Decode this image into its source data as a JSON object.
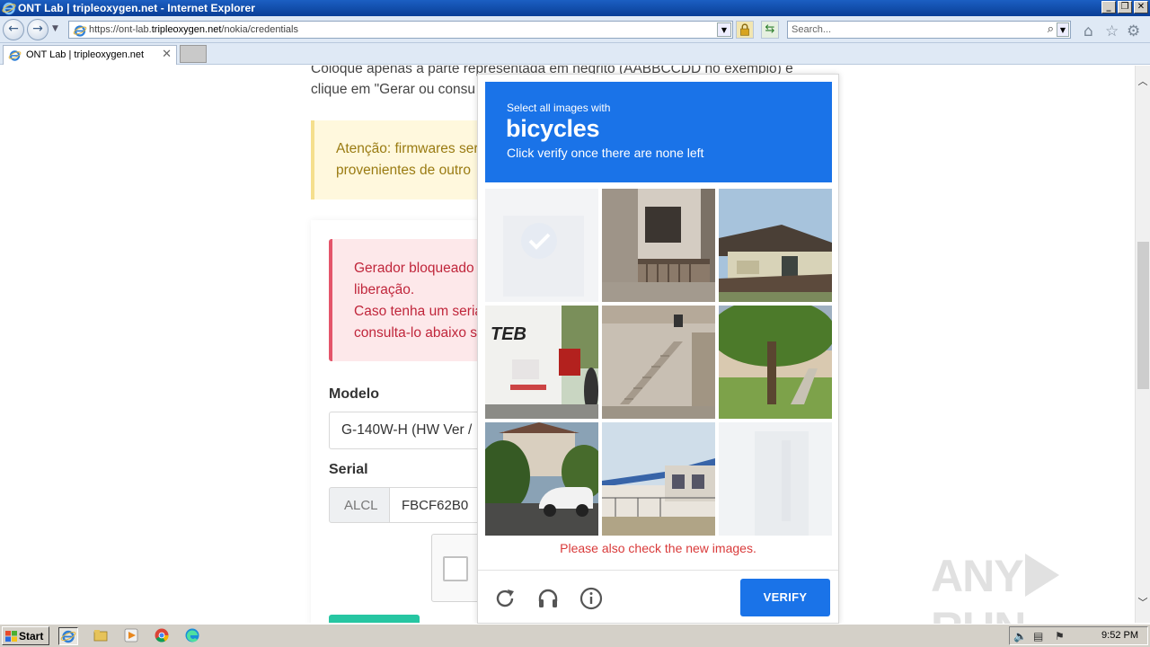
{
  "window": {
    "title": "ONT Lab | tripleoxygen.net - Internet Explorer",
    "controls": [
      "_",
      "❐",
      "✕"
    ]
  },
  "navbar": {
    "url_prefix": "https://ont-lab.",
    "url_domain": "tripleoxygen.net",
    "url_path": "/nokia/credentials",
    "search_placeholder": "Search..."
  },
  "tabs": [
    {
      "label": "ONT Lab | tripleoxygen.net"
    }
  ],
  "page": {
    "intro_line1": "Coloque apenas a parte representada em negrito (AABBCCDD no exemplo) e",
    "intro_line2": "clique em \"Gerar ou consu",
    "warning_line1": "Atenção: firmwares ser",
    "warning_line2": "provenientes de outro",
    "error_line1": "Gerador bloqueado",
    "error_line2": "liberação.",
    "error_line3": "Caso tenha um seria",
    "error_line4": "consulta-lo abaixo s",
    "model_label": "Modelo",
    "model_value": "G-140W-H (HW Ver /",
    "serial_label": "Serial",
    "serial_prefix": "ALCL",
    "serial_value": "FBCF62B0"
  },
  "captcha": {
    "prompt_small": "Select all images with",
    "prompt_keyword": "bicycles",
    "prompt_hint": "Click verify once there are none left",
    "error_message": "Please also check the new images.",
    "verify_label": "VERIFY",
    "tiles": [
      {
        "name": "tile-1",
        "state": "selected-fading"
      },
      {
        "name": "tile-2",
        "content": "building-balcony"
      },
      {
        "name": "tile-3",
        "content": "house-roof"
      },
      {
        "name": "tile-4",
        "content": "bus-TEB"
      },
      {
        "name": "tile-5",
        "content": "stairs"
      },
      {
        "name": "tile-6",
        "content": "tree-yard"
      },
      {
        "name": "tile-7",
        "content": "car-street"
      },
      {
        "name": "tile-8",
        "content": "blue-roof-building"
      },
      {
        "name": "tile-9",
        "state": "loading-fading"
      }
    ],
    "accent_color": "#1a73e8",
    "error_color": "#d93a3a"
  },
  "watermark": {
    "left": "ANY",
    "right": "RUN"
  },
  "taskbar": {
    "start_label": "Start",
    "clock": "9:52 PM"
  }
}
